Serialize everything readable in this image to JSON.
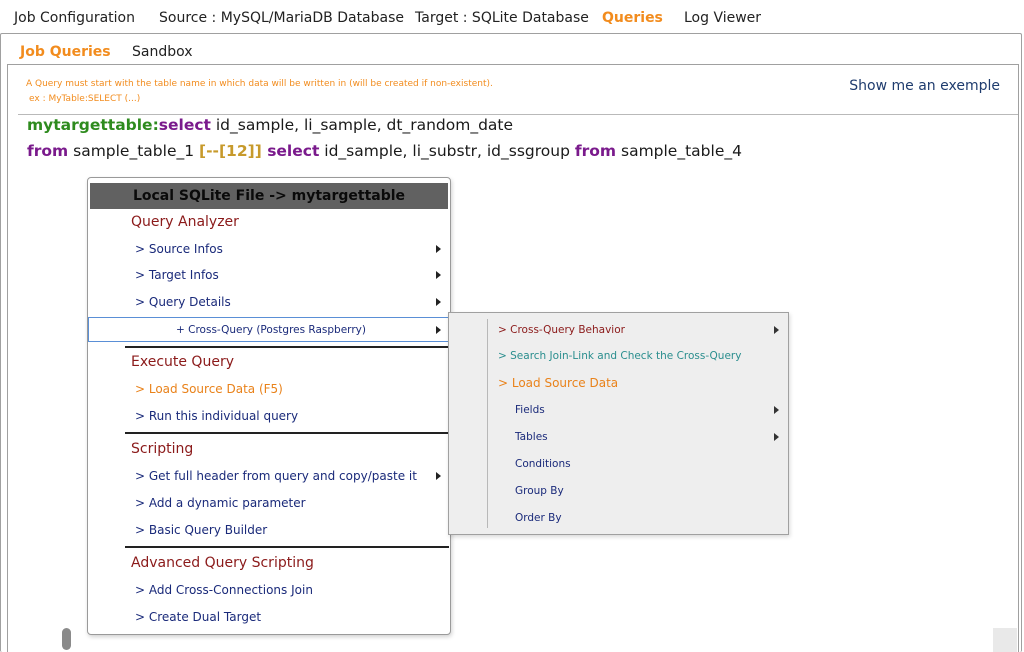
{
  "top_tabs": [
    {
      "label": "Job Configuration",
      "active": false
    },
    {
      "label": "Source : MySQL/MariaDB Database",
      "active": false
    },
    {
      "label": "Target : SQLite Database",
      "active": false
    },
    {
      "label": "Queries",
      "active": true
    },
    {
      "label": "Log Viewer",
      "active": false
    }
  ],
  "sub_tabs": [
    {
      "label": "Job Queries",
      "active": true
    },
    {
      "label": "Sandbox",
      "active": false
    }
  ],
  "hint": {
    "line1": "A Query must start with the table name in which data will be written in (will be created if non-existent).",
    "line2": "ex : MyTable:SELECT (...)"
  },
  "show_example": "Show me an exemple",
  "editor": {
    "line1": {
      "target": "mytargettable:",
      "kw1": "select",
      "rest": " id_sample, li_sample, dt_random_date"
    },
    "line2": {
      "kw_from": "from",
      "t1": " sample_table_1 ",
      "marker": "[--[12]]",
      "kw_select": " select",
      "t2": " id_sample, li_substr, id_ssgroup ",
      "kw_from2": "from",
      "t3": " sample_table_4"
    }
  },
  "context_menu": {
    "title": "Local SQLite File -> mytargettable",
    "query_analyzer": {
      "heading": "Query Analyzer",
      "items": [
        "> Source Infos",
        "> Target Infos",
        "> Query Details"
      ],
      "highlighted": "+ Cross-Query (Postgres Raspberry)"
    },
    "execute_query": {
      "heading": "Execute Query",
      "items": [
        "> Load Source Data (F5)",
        "> Run this individual query"
      ]
    },
    "scripting": {
      "heading": "Scripting",
      "items": [
        "> Get full header from query and copy/paste it",
        "> Add a dynamic parameter",
        "> Basic Query Builder"
      ]
    },
    "advanced_scripting": {
      "heading": "Advanced Query Scripting",
      "items": [
        "> Add Cross-Connections Join",
        "> Create Dual Target"
      ]
    }
  },
  "sub_menu": {
    "cross_query_behavior": "> Cross-Query Behavior",
    "search_join_link": "> Search Join-Link and Check the Cross-Query",
    "load_source_data": "> Load Source Data",
    "items": [
      "Fields",
      "Tables",
      "Conditions",
      "Group By",
      "Order By"
    ]
  },
  "colors": {
    "accent_orange": "#f28c1e",
    "section_red": "#8b1a1a",
    "menu_navy": "#1a2a7a",
    "teal": "#2a8e8e",
    "keyword_purple": "#7a1a8c",
    "target_green": "#2e8b1e"
  }
}
